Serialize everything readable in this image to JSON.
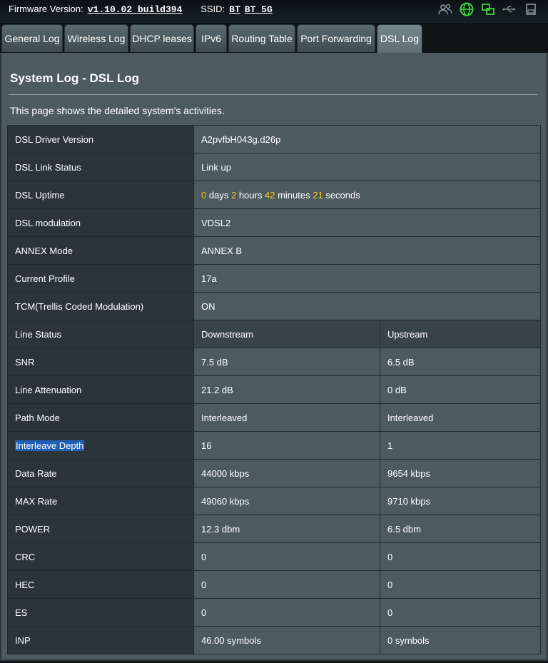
{
  "topbar": {
    "firmware_label": "Firmware Version:",
    "firmware_value": "v1.10.02_build394",
    "ssid_label": "SSID:",
    "ssid_1": "BT",
    "ssid_2": "BT_5G",
    "icons": [
      "users-icon",
      "globe-icon",
      "network-icon",
      "usb-icon",
      "printer-icon"
    ]
  },
  "tabs": [
    {
      "label": "General Log"
    },
    {
      "label": "Wireless Log"
    },
    {
      "label": "DHCP leases"
    },
    {
      "label": "IPv6"
    },
    {
      "label": "Routing Table"
    },
    {
      "label": "Port Forwarding"
    },
    {
      "label": "DSL Log",
      "active": true
    }
  ],
  "page": {
    "title": "System Log - DSL Log",
    "description": "This page shows the detailed system's activities."
  },
  "info": {
    "driver_label": "DSL Driver Version",
    "driver_value": "A2pvfbH043g.d26p",
    "link_label": "DSL Link Status",
    "link_value": "Link up",
    "uptime_label": "DSL Uptime",
    "uptime": {
      "days": "0",
      "days_unit": "days",
      "hours": "2",
      "hours_unit": "hours",
      "minutes": "42",
      "minutes_unit": "minutes",
      "seconds": "21",
      "seconds_unit": "seconds"
    },
    "modulation_label": "DSL modulation",
    "modulation_value": "VDSL2",
    "annex_label": "ANNEX Mode",
    "annex_value": "ANNEX B",
    "profile_label": "Current Profile",
    "profile_value": "17a",
    "tcm_label": "TCM(Trellis Coded Modulation)",
    "tcm_value": "ON"
  },
  "line": {
    "header": {
      "label": "Line Status",
      "down": "Downstream",
      "up": "Upstream"
    },
    "rows": [
      {
        "label": "SNR",
        "down": "7.5 dB",
        "up": "6.5 dB"
      },
      {
        "label": "Line Attenuation",
        "down": "21.2 dB",
        "up": "0 dB"
      },
      {
        "label": "Path Mode",
        "down": "Interleaved",
        "up": "Interleaved"
      },
      {
        "label": "Interleave Depth",
        "down": "16",
        "up": "1"
      },
      {
        "label": "Data Rate",
        "down": "44000 kbps",
        "up": "9654 kbps"
      },
      {
        "label": "MAX Rate",
        "down": "49060 kbps",
        "up": "9710 kbps"
      },
      {
        "label": "POWER",
        "down": "12.3 dbm",
        "up": "6.5 dbm"
      },
      {
        "label": "CRC",
        "down": "0",
        "up": "0"
      },
      {
        "label": "HEC",
        "down": "0",
        "up": "0"
      },
      {
        "label": "ES",
        "down": "0",
        "up": "0"
      },
      {
        "label": "INP",
        "down": "46.00 symbols",
        "up": "0 symbols"
      }
    ]
  },
  "colors": {
    "accent": "#f5c518",
    "highlight": "#1f5fb8",
    "panel": "#4d5b5f",
    "label_cell": "#2b3539"
  }
}
